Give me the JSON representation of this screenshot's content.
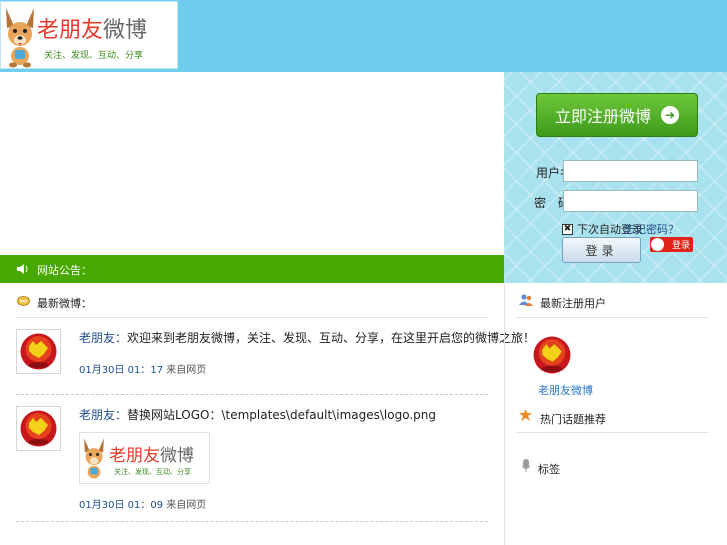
{
  "header": {
    "logo_title_red": "老朋友",
    "logo_title_grey": "微博",
    "logo_slogan": "关注、发现、互动、分享"
  },
  "login": {
    "register_label": "立即注册微博",
    "username_label": "用户名：",
    "password_label": "密　码：",
    "username_value": "",
    "password_value": "",
    "remember_label": "下次自动登录",
    "forgot_label": "忘记密码？",
    "login_label": "登录",
    "weibo_login_label": "登录"
  },
  "notice": {
    "text": "网站公告："
  },
  "feed": {
    "title": "最新微博：",
    "posts": [
      {
        "author": "老朋友：",
        "text": "欢迎来到老朋友微博，关注、发现、互动、分享，在这里开启您的微博之旅！",
        "time": "01月30日 01：17",
        "via": "来自网页"
      },
      {
        "author": "老朋友：",
        "text": "替换网站LOGO：\\templates\\default\\images\\logo.png",
        "time": "01月30日 01：09",
        "via": "来自网页",
        "image_title_red": "老朋友",
        "image_title_grey": "微博",
        "image_slogan": "关注、发现、互动、分享"
      }
    ]
  },
  "sidebar": {
    "new_users_title": "最新注册用户",
    "new_user_name": "老朋友微博",
    "hot_topics_title": "热门话题推荐",
    "tags_title": "标签"
  },
  "colors": {
    "header_bg": "#6fcdee",
    "notice_bg": "#46a800",
    "link": "#1f4e8c",
    "logo_red": "#e63a2c"
  }
}
